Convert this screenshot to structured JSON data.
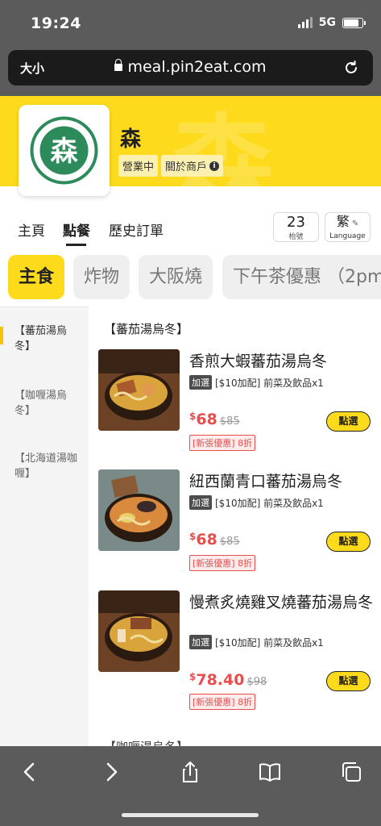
{
  "status_bar": {
    "time": "19:24",
    "network": "5G"
  },
  "browser": {
    "text_size": "大小",
    "url": "meal.pin2eat.com"
  },
  "store": {
    "name": "森",
    "status_badge": "營業中",
    "about_badge": "關於商戶"
  },
  "nav": {
    "tabs": [
      "主頁",
      "點餐",
      "歷史訂單"
    ],
    "active_tab": "點餐",
    "table_number": "23",
    "table_label": "枱號",
    "language_char": "繁",
    "language_label": "Language"
  },
  "categories": [
    "主食",
    "炸物",
    "大阪燒",
    "下午茶優惠 （2pm"
  ],
  "sidebar": {
    "items": [
      "【蕃茄湯烏冬】",
      "【咖喱湯烏冬】",
      "【北海道湯咖喱】"
    ]
  },
  "menu": {
    "section_title": "【蕃茄湯烏冬】",
    "next_section_title": "【咖喱湯烏冬】",
    "items": [
      {
        "name": "香煎大蝦蕃茄湯烏冬",
        "option_tag": "加選",
        "option_text": "[$10加配] 前菜及飲品x1",
        "currency": "$",
        "price": "68",
        "old_price": "$85",
        "discount": "[新張優惠] 8折",
        "button": "點選"
      },
      {
        "name": "紐西蘭青口蕃茄湯烏冬",
        "option_tag": "加選",
        "option_text": "[$10加配] 前菜及飲品x1",
        "currency": "$",
        "price": "68",
        "old_price": "$85",
        "discount": "[新張優惠] 8折",
        "button": "點選"
      },
      {
        "name": "慢煮炙燒雞叉燒蕃茄湯烏冬",
        "option_tag": "加選",
        "option_text": "[$10加配] 前菜及飲品x1",
        "currency": "$",
        "price": "78.40",
        "old_price": "$98",
        "discount": "[新張優惠] 8折",
        "button": "點選"
      }
    ]
  },
  "colors": {
    "accent": "#fddb1c",
    "price": "#e84e4e",
    "chrome": "#5b5b5b"
  },
  "logo_mark": "森"
}
